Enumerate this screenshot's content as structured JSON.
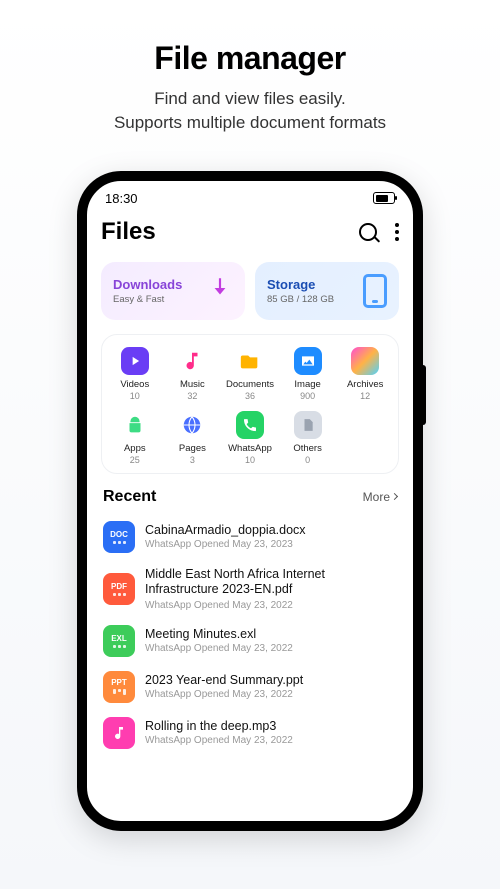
{
  "hero": {
    "title": "File manager",
    "subtitle_line1": "Find and view files easily.",
    "subtitle_line2": "Supports multiple document formats"
  },
  "status": {
    "time": "18:30"
  },
  "header": {
    "title": "Files"
  },
  "cards": {
    "downloads": {
      "title": "Downloads",
      "subtitle": "Easy & Fast"
    },
    "storage": {
      "title": "Storage",
      "subtitle": "85 GB / 128 GB"
    }
  },
  "categories": [
    {
      "label": "Videos",
      "count": "10"
    },
    {
      "label": "Music",
      "count": "32"
    },
    {
      "label": "Documents",
      "count": "36"
    },
    {
      "label": "Image",
      "count": "900"
    },
    {
      "label": "Archives",
      "count": "12"
    },
    {
      "label": "Apps",
      "count": "25"
    },
    {
      "label": "Pages",
      "count": "3"
    },
    {
      "label": "WhatsApp",
      "count": "10"
    },
    {
      "label": "Others",
      "count": "0"
    }
  ],
  "recent": {
    "title": "Recent",
    "more": "More",
    "items": [
      {
        "type": "DOC",
        "name": "CabinaArmadio_doppia.docx",
        "meta": "WhatsApp  Opened  May 23, 2023"
      },
      {
        "type": "PDF",
        "name": "Middle East North Africa Internet Infrastructure 2023-EN.pdf",
        "meta": "WhatsApp  Opened  May 23, 2022"
      },
      {
        "type": "EXL",
        "name": "Meeting Minutes.exl",
        "meta": "WhatsApp  Opened  May 23, 2022"
      },
      {
        "type": "PPT",
        "name": "2023 Year-end Summary.ppt",
        "meta": "WhatsApp  Opened  May 23, 2022"
      },
      {
        "type": "MUS",
        "name": "Rolling in the deep.mp3",
        "meta": "WhatsApp  Opened  May 23, 2022"
      }
    ]
  }
}
